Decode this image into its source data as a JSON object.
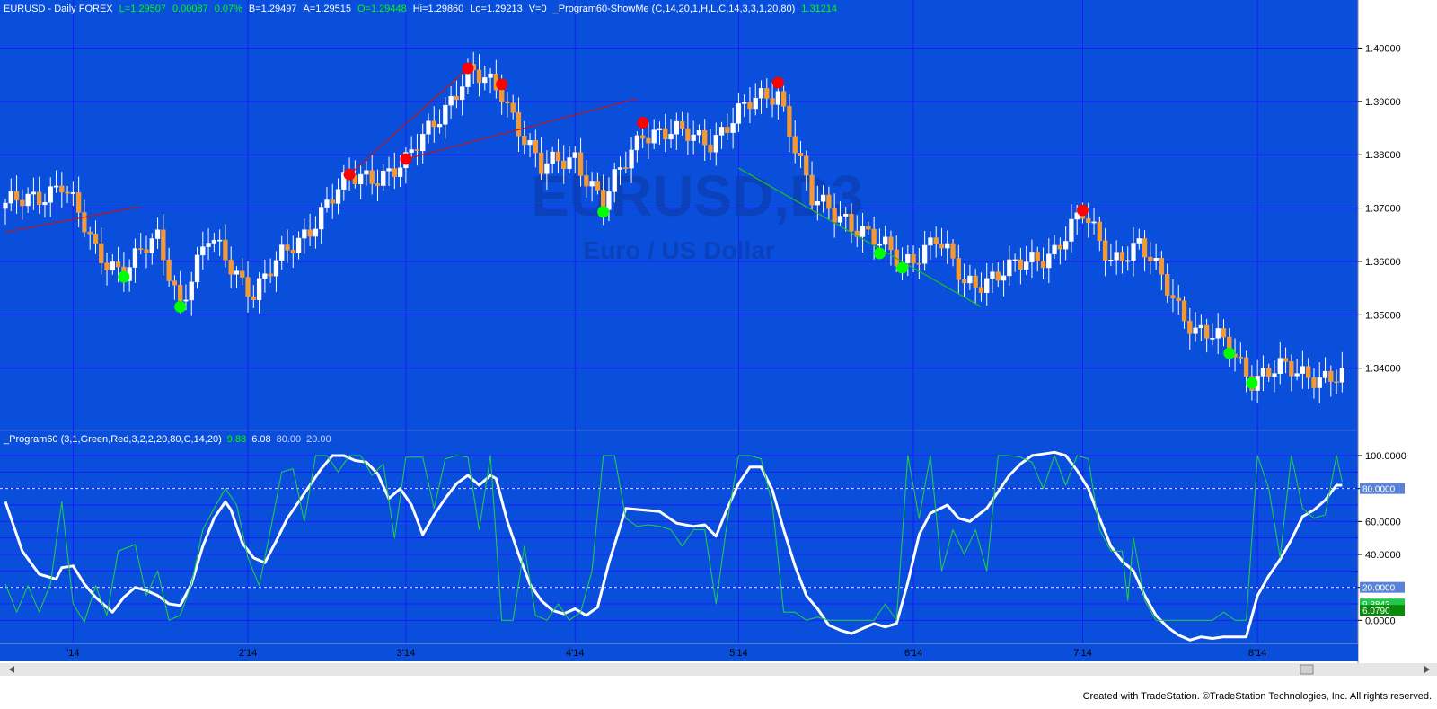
{
  "colors": {
    "background": "#0a4fdc",
    "grid": "#1a1aff",
    "border": "#c8c8c8",
    "up_candle": "#ffffff",
    "down_candle": "#f59a32",
    "wick": "#ffffff",
    "high_dot": "#ff0000",
    "low_dot": "#00ff00",
    "trend_red": "#c01414",
    "trend_green": "#22bb22",
    "osc_main": "#ffffff",
    "osc_signal": "#22c84a",
    "watermark": "#0c3eb0",
    "axis_panel": "#ffffff",
    "header_text": "#ffffff",
    "header_green": "#00ff00"
  },
  "header": {
    "symbol_line": "EURUSD - Daily  FOREX",
    "last": "L=1.29507",
    "change": "0.00087",
    "change_pct": "0.07%",
    "bid": "B=1.29497",
    "ask": "A=1.29515",
    "open": "O=1.29448",
    "high": "Hi=1.29860",
    "low": "Lo=1.29213",
    "volume": "V=0",
    "indicator": "_Program60-ShowMe (C,14,20,1,H,L,C,14,3,3,1,20,80)",
    "indicator_value": "1.31214"
  },
  "watermark": {
    "symbol": "EURUSD,D3",
    "name": "Euro / US Dollar"
  },
  "osc_header": {
    "label": "_Program60 (3,1,Green,Red,3,2,2,20,80,C,14,20)",
    "v1": "9.88",
    "v2": "6.08",
    "v3": "80.00",
    "v4": "20.00"
  },
  "footer": "Created with TradeStation. ©TradeStation Technologies, Inc. All rights reserved.",
  "chart_data": [
    {
      "type": "candlestick",
      "title": "EURUSD - Daily FOREX",
      "y_ticks": [
        1.34,
        1.35,
        1.36,
        1.37,
        1.38,
        1.39,
        1.4
      ],
      "y_tick_labels": [
        "1.34000",
        "1.35000",
        "1.36000",
        "1.37000",
        "1.38000",
        "1.39000",
        "1.40000"
      ],
      "ylim": [
        1.3285,
        1.409
      ],
      "x_tick_labels": [
        "'14",
        "2'14",
        "3'14",
        "4'14",
        "5'14",
        "6'14",
        "7'14",
        "8'14"
      ],
      "candle_count": 238,
      "swing_highs": [
        {
          "bar": 61,
          "value": 1.3763
        },
        {
          "bar": 71,
          "value": 1.3792
        },
        {
          "bar": 82,
          "value": 1.3962
        },
        {
          "bar": 88,
          "value": 1.3932
        },
        {
          "bar": 113,
          "value": 1.386
        },
        {
          "bar": 137,
          "value": 1.3935
        },
        {
          "bar": 191,
          "value": 1.3696
        }
      ],
      "swing_lows": [
        {
          "bar": 21,
          "value": 1.3571
        },
        {
          "bar": 31,
          "value": 1.3515
        },
        {
          "bar": 106,
          "value": 1.3693
        },
        {
          "bar": 155,
          "value": 1.3615
        },
        {
          "bar": 159,
          "value": 1.3588
        },
        {
          "bar": 217,
          "value": 1.3428
        },
        {
          "bar": 221,
          "value": 1.3372
        }
      ],
      "trendlines": [
        {
          "color": "red",
          "from": {
            "bar": 0,
            "value": 1.3655
          },
          "to": {
            "bar": 24,
            "value": 1.3703
          }
        },
        {
          "color": "red",
          "from": {
            "bar": 61,
            "value": 1.3763
          },
          "to": {
            "bar": 82,
            "value": 1.3962
          }
        },
        {
          "color": "red",
          "from": {
            "bar": 71,
            "value": 1.3792
          },
          "to": {
            "bar": 112,
            "value": 1.3905
          }
        },
        {
          "color": "green",
          "from": {
            "bar": 130,
            "value": 1.3775
          },
          "to": {
            "bar": 173,
            "value": 1.3515
          }
        }
      ]
    },
    {
      "type": "line",
      "title": "_Program60 (3,1,Green,Red,3,2,2,20,80,C,14,20)",
      "y_ticks": [
        0,
        20,
        40,
        60,
        80,
        100
      ],
      "y_tick_labels": [
        "0.0000",
        "20.0000",
        "40.0000",
        "60.0000",
        "80.0000",
        "100.0000"
      ],
      "ylim": [
        -14,
        106
      ],
      "dashed_levels": [
        20,
        80
      ],
      "value_labels": [
        "80.0000",
        "20.0000",
        "9.8843",
        "6.0790"
      ],
      "x_tick_labels": [
        "'14",
        "2'14",
        "3'14",
        "4'14",
        "5'14",
        "6'14",
        "7'14",
        "8'14"
      ],
      "series": [
        {
          "color": "white",
          "points": [
            [
              0,
              72
            ],
            [
              3,
              42
            ],
            [
              6,
              28
            ],
            [
              9,
              25
            ],
            [
              10,
              32
            ],
            [
              12,
              33
            ],
            [
              14,
              22
            ],
            [
              16,
              14
            ],
            [
              18,
              8
            ],
            [
              19,
              5
            ],
            [
              21,
              14
            ],
            [
              23,
              20
            ],
            [
              25,
              18
            ],
            [
              27,
              15
            ],
            [
              29,
              10
            ],
            [
              31,
              9
            ],
            [
              33,
              22
            ],
            [
              35,
              45
            ],
            [
              37,
              62
            ],
            [
              39,
              72
            ],
            [
              40,
              67
            ],
            [
              42,
              47
            ],
            [
              44,
              38
            ],
            [
              46,
              35
            ],
            [
              48,
              48
            ],
            [
              50,
              62
            ],
            [
              52,
              72
            ],
            [
              54,
              82
            ],
            [
              56,
              92
            ],
            [
              58,
              100
            ],
            [
              60,
              100
            ],
            [
              62,
              97
            ],
            [
              64,
              96
            ],
            [
              66,
              89
            ],
            [
              68,
              74
            ],
            [
              70,
              80
            ],
            [
              72,
              70
            ],
            [
              74,
              52
            ],
            [
              76,
              64
            ],
            [
              78,
              74
            ],
            [
              80,
              83
            ],
            [
              82,
              88
            ],
            [
              84,
              82
            ],
            [
              86,
              88
            ],
            [
              87,
              86
            ],
            [
              89,
              60
            ],
            [
              91,
              40
            ],
            [
              93,
              22
            ],
            [
              95,
              12
            ],
            [
              97,
              6
            ],
            [
              99,
              4
            ],
            [
              101,
              7
            ],
            [
              103,
              3
            ],
            [
              105,
              8
            ],
            [
              107,
              35
            ],
            [
              110,
              68
            ],
            [
              113,
              67
            ],
            [
              116,
              66
            ],
            [
              119,
              59
            ],
            [
              122,
              57
            ],
            [
              124,
              58
            ],
            [
              126,
              51
            ],
            [
              128,
              68
            ],
            [
              130,
              83
            ],
            [
              132,
              93
            ],
            [
              134,
              93
            ],
            [
              136,
              79
            ],
            [
              138,
              55
            ],
            [
              140,
              33
            ],
            [
              142,
              15
            ],
            [
              144,
              7
            ],
            [
              146,
              -3
            ],
            [
              148,
              -6
            ],
            [
              150,
              -8
            ],
            [
              152,
              -5
            ],
            [
              154,
              -2
            ],
            [
              156,
              -4
            ],
            [
              158,
              -2
            ],
            [
              160,
              23
            ],
            [
              162,
              52
            ],
            [
              164,
              65
            ],
            [
              167,
              70
            ],
            [
              169,
              62
            ],
            [
              171,
              60
            ],
            [
              174,
              68
            ],
            [
              176,
              78
            ],
            [
              178,
              88
            ],
            [
              180,
              95
            ],
            [
              182,
              100
            ],
            [
              184,
              101
            ],
            [
              186,
              102
            ],
            [
              188,
              100
            ],
            [
              190,
              91
            ],
            [
              192,
              80
            ],
            [
              194,
              62
            ],
            [
              196,
              45
            ],
            [
              198,
              36
            ],
            [
              200,
              30
            ],
            [
              202,
              15
            ],
            [
              204,
              3
            ],
            [
              206,
              -4
            ],
            [
              208,
              -9
            ],
            [
              210,
              -12
            ],
            [
              212,
              -10
            ],
            [
              214,
              -11
            ],
            [
              216,
              -10
            ],
            [
              218,
              -10
            ],
            [
              220,
              -10
            ],
            [
              222,
              15
            ],
            [
              224,
              27
            ],
            [
              226,
              37
            ],
            [
              228,
              49
            ],
            [
              230,
              63
            ],
            [
              232,
              67
            ],
            [
              234,
              73
            ],
            [
              236,
              82
            ],
            [
              237,
              82
            ]
          ]
        },
        {
          "color": "green",
          "points": [
            [
              0,
              22
            ],
            [
              2,
              5
            ],
            [
              4,
              21
            ],
            [
              6,
              5
            ],
            [
              8,
              22
            ],
            [
              10,
              72
            ],
            [
              12,
              10
            ],
            [
              14,
              -1
            ],
            [
              16,
              21
            ],
            [
              18,
              3
            ],
            [
              20,
              42
            ],
            [
              23,
              46
            ],
            [
              25,
              15
            ],
            [
              27,
              30
            ],
            [
              29,
              0
            ],
            [
              31,
              3
            ],
            [
              33,
              22
            ],
            [
              35,
              55
            ],
            [
              37,
              68
            ],
            [
              39,
              80
            ],
            [
              41,
              70
            ],
            [
              43,
              38
            ],
            [
              45,
              21
            ],
            [
              47,
              55
            ],
            [
              49,
              90
            ],
            [
              51,
              92
            ],
            [
              53,
              60
            ],
            [
              55,
              100
            ],
            [
              57,
              100
            ],
            [
              59,
              90
            ],
            [
              61,
              100
            ],
            [
              63,
              100
            ],
            [
              65,
              88
            ],
            [
              67,
              95
            ],
            [
              69,
              50
            ],
            [
              71,
              99
            ],
            [
              72,
              99
            ],
            [
              74,
              99
            ],
            [
              76,
              68
            ],
            [
              78,
              98
            ],
            [
              80,
              100
            ],
            [
              82,
              99
            ],
            [
              84,
              55
            ],
            [
              86,
              100
            ],
            [
              88,
              0
            ],
            [
              90,
              0
            ],
            [
              92,
              45
            ],
            [
              94,
              3
            ],
            [
              96,
              0
            ],
            [
              98,
              10
            ],
            [
              100,
              0
            ],
            [
              102,
              5
            ],
            [
              104,
              30
            ],
            [
              106,
              100
            ],
            [
              108,
              100
            ],
            [
              110,
              62
            ],
            [
              112,
              57
            ],
            [
              114,
              58
            ],
            [
              116,
              57
            ],
            [
              118,
              55
            ],
            [
              120,
              45
            ],
            [
              122,
              55
            ],
            [
              124,
              55
            ],
            [
              126,
              10
            ],
            [
              128,
              60
            ],
            [
              130,
              100
            ],
            [
              132,
              100
            ],
            [
              134,
              98
            ],
            [
              136,
              70
            ],
            [
              138,
              5
            ],
            [
              140,
              5
            ],
            [
              142,
              0
            ],
            [
              144,
              2
            ],
            [
              146,
              0
            ],
            [
              148,
              0
            ],
            [
              150,
              0
            ],
            [
              152,
              0
            ],
            [
              154,
              0
            ],
            [
              156,
              10
            ],
            [
              158,
              0
            ],
            [
              160,
              100
            ],
            [
              162,
              62
            ],
            [
              164,
              100
            ],
            [
              166,
              30
            ],
            [
              168,
              55
            ],
            [
              170,
              40
            ],
            [
              172,
              55
            ],
            [
              174,
              30
            ],
            [
              176,
              100
            ],
            [
              178,
              100
            ],
            [
              180,
              99
            ],
            [
              182,
              96
            ],
            [
              184,
              80
            ],
            [
              186,
              100
            ],
            [
              188,
              82
            ],
            [
              190,
              100
            ],
            [
              192,
              98
            ],
            [
              194,
              55
            ],
            [
              196,
              42
            ],
            [
              198,
              42
            ],
            [
              199,
              12
            ],
            [
              200,
              50
            ],
            [
              202,
              12
            ],
            [
              204,
              0
            ],
            [
              206,
              0
            ],
            [
              208,
              0
            ],
            [
              210,
              0
            ],
            [
              212,
              0
            ],
            [
              214,
              0
            ],
            [
              216,
              5
            ],
            [
              218,
              0
            ],
            [
              220,
              0
            ],
            [
              222,
              100
            ],
            [
              224,
              80
            ],
            [
              226,
              38
            ],
            [
              228,
              100
            ],
            [
              230,
              68
            ],
            [
              232,
              62
            ],
            [
              234,
              64
            ],
            [
              236,
              100
            ],
            [
              237,
              84
            ]
          ]
        }
      ]
    }
  ]
}
